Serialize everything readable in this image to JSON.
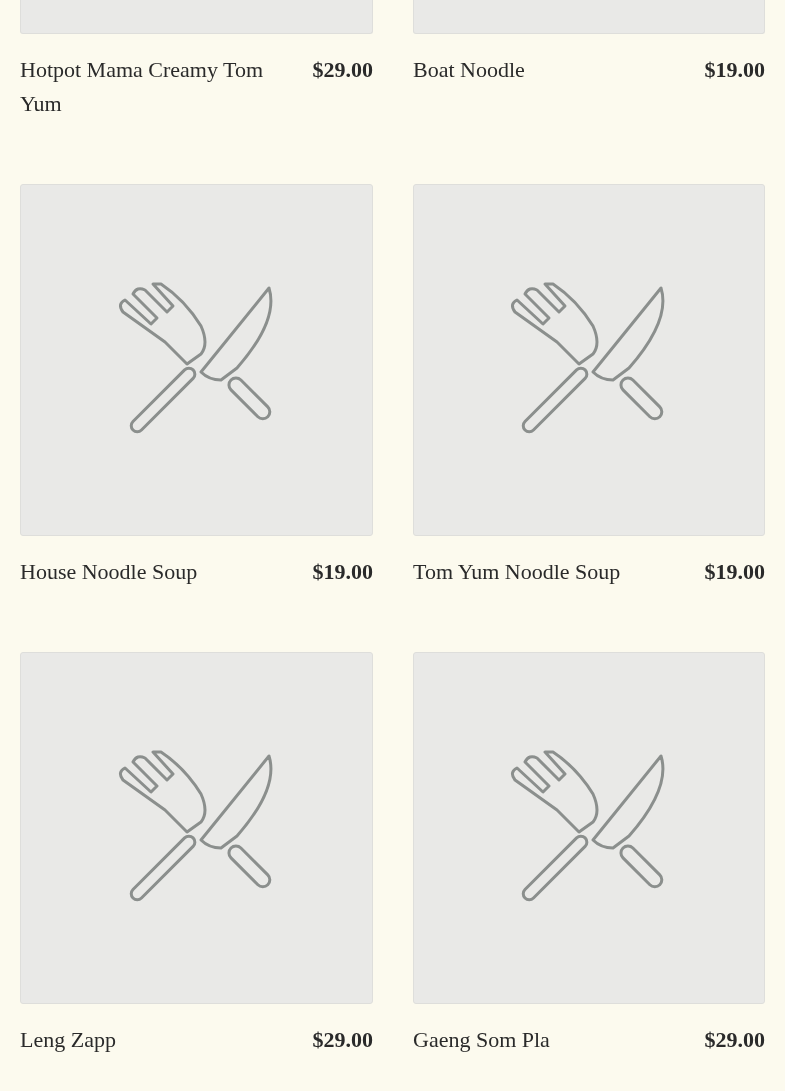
{
  "items": [
    {
      "name": "Hotpot Mama Creamy Tom Yum",
      "price": "$29.00"
    },
    {
      "name": "Boat Noodle",
      "price": "$19.00"
    },
    {
      "name": "House Noodle Soup",
      "price": "$19.00"
    },
    {
      "name": "Tom Yum Noodle Soup",
      "price": "$19.00"
    },
    {
      "name": "Leng Zapp",
      "price": "$29.00"
    },
    {
      "name": "Gaeng Som Pla",
      "price": "$29.00"
    }
  ]
}
